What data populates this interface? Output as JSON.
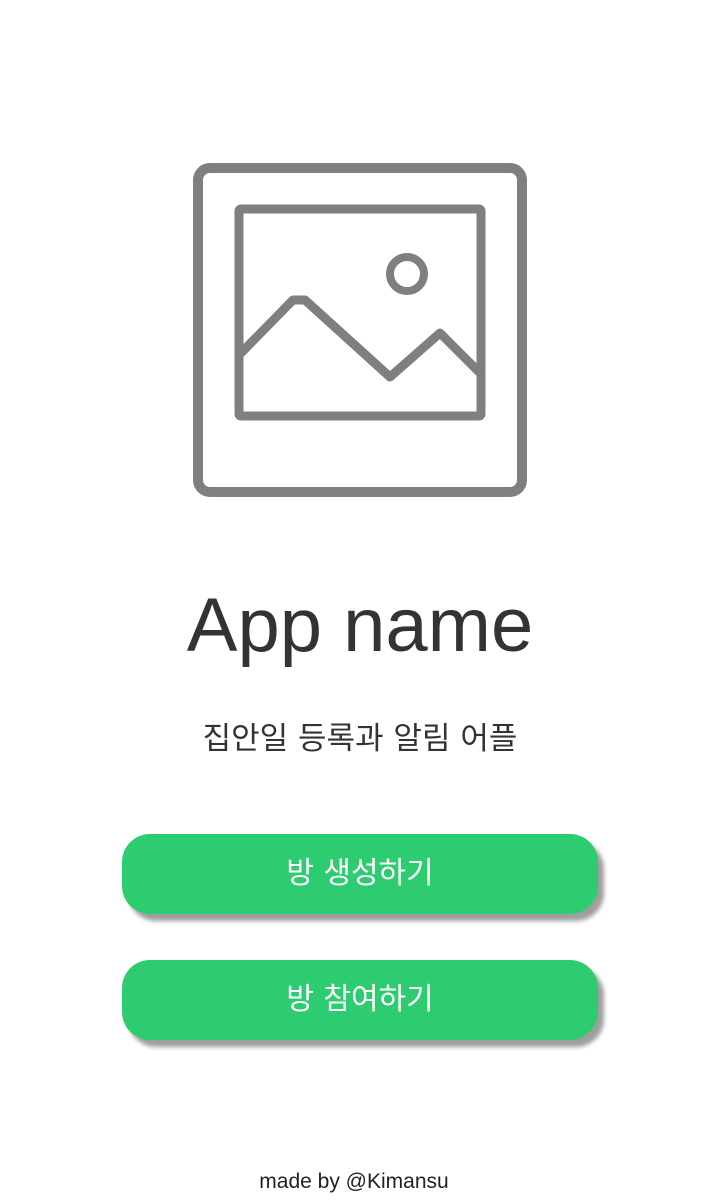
{
  "logo": {
    "icon": "image-placeholder-icon",
    "stroke_color": "#7f7f7f"
  },
  "app": {
    "name": "App name",
    "subtitle": "집안일 등록과 알림 어플"
  },
  "buttons": {
    "create_room_label": "방 생성하기",
    "join_room_label": "방 참여하기",
    "color": "#2ecc71"
  },
  "footer": {
    "credit": "made by @Kimansu"
  }
}
